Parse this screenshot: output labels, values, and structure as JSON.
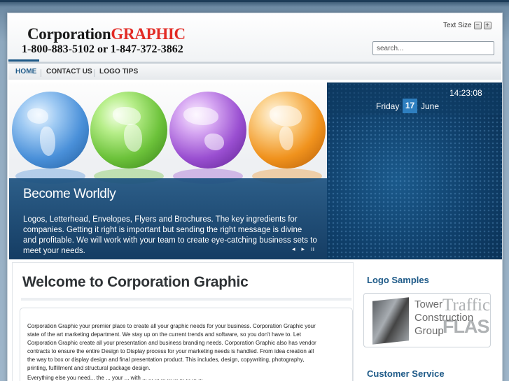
{
  "header": {
    "logo_main": "Corporation",
    "logo_accent": "GRAPHIC",
    "phone": "1-800-883-5102 or 1-847-372-3862",
    "text_size_label": "Text Size",
    "text_size_minus": "−",
    "text_size_plus": "+",
    "search_placeholder": "search..."
  },
  "nav": {
    "items": [
      {
        "label": "HOME"
      },
      {
        "label": "CONTACT US"
      },
      {
        "label": "LOGO TIPS"
      }
    ]
  },
  "banner": {
    "title": "Become Worldly",
    "body": "Logos, Letterhead, Envelopes, Flyers and Brochures. The key ingredients for companies. Getting it right is important but sending the right message is divine and profitable. We will work with your team to create eye-catching business sets to meet your needs.",
    "controls": {
      "prev": "◂",
      "next": "▸",
      "pause": "ıı"
    },
    "globe_colors": [
      "#4a90d9",
      "#6cc23a",
      "#9a4fd1",
      "#f0921d"
    ]
  },
  "clock": {
    "time": "14:23:08",
    "day_name": "Friday",
    "day_number": "17",
    "month": "June"
  },
  "main": {
    "title": "Welcome to Corporation Graphic",
    "intro": "Corporation Graphic your premier place to create all your graphic needs for your business.  Corporation Graphic your state of the art marketing department.  We stay up on the current trends and software, so you don't have to. Let Corporation Graphic create all your presentation and business branding needs. Corporation Graphic also has vendor contracts to ensure the entire Design to Display process for your marketing needs is handled.  From idea creation all the way to box or display design and final presentation product.  This includes, design, copywriting, photography, printing, fulfillment and structural package design.",
    "intro_cut": "Everything else you need...   the ...  your ...  with ... ... ... ... ... ...   ...  ...   ... ..."
  },
  "sidebar": {
    "logo_samples_heading": "Logo Samples",
    "sample_lines": [
      "Tower",
      "Construction",
      "Group"
    ],
    "sample_traffic": "Traffic",
    "sample_flash": "FLASH",
    "customer_service_heading": "Customer Service"
  }
}
